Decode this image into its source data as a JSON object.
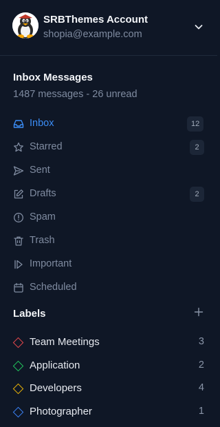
{
  "account": {
    "name": "SRBThemes Account",
    "email": "shopia@example.com"
  },
  "inbox_section": {
    "title": "Inbox Messages",
    "subtitle": "1487 messages - 26 unread"
  },
  "nav": [
    {
      "label": "Inbox",
      "icon": "inbox-icon",
      "badge": "12",
      "active": true
    },
    {
      "label": "Starred",
      "icon": "star-icon",
      "badge": "2",
      "active": false
    },
    {
      "label": "Sent",
      "icon": "send-icon",
      "badge": "",
      "active": false
    },
    {
      "label": "Drafts",
      "icon": "edit-icon",
      "badge": "2",
      "active": false
    },
    {
      "label": "Spam",
      "icon": "alert-circle-icon",
      "badge": "",
      "active": false
    },
    {
      "label": "Trash",
      "icon": "trash-icon",
      "badge": "",
      "active": false
    },
    {
      "label": "Important",
      "icon": "important-icon",
      "badge": "",
      "active": false
    },
    {
      "label": "Scheduled",
      "icon": "calendar-icon",
      "badge": "",
      "active": false
    }
  ],
  "labels_section": {
    "title": "Labels"
  },
  "labels": [
    {
      "label": "Team Meetings",
      "count": "3",
      "color": "#e5484d"
    },
    {
      "label": "Application",
      "count": "2",
      "color": "#22c55e"
    },
    {
      "label": "Developers",
      "count": "4",
      "color": "#eab308"
    },
    {
      "label": "Photographer",
      "count": "1",
      "color": "#3b82f6"
    }
  ],
  "colors": {
    "background": "#0f1726",
    "accent": "#3b8df6",
    "muted": "#7f8ba0"
  }
}
